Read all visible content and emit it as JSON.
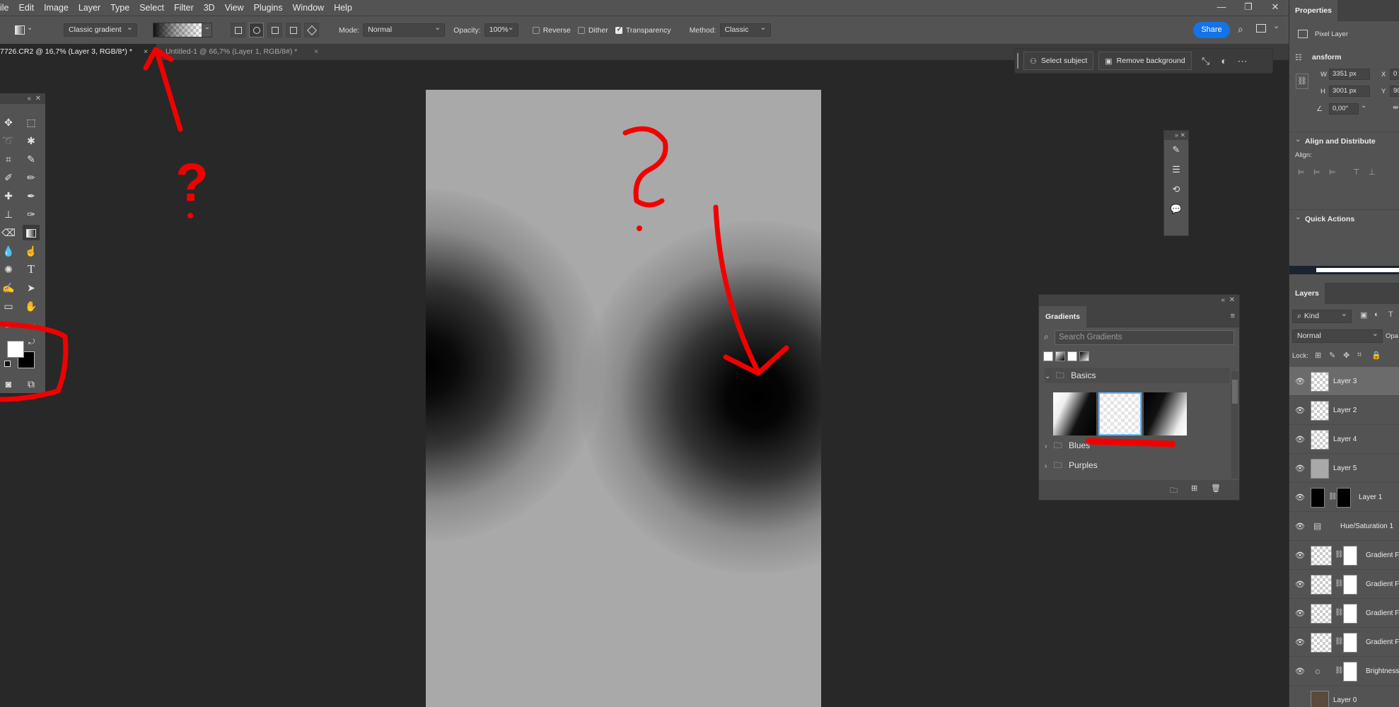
{
  "menu": [
    "ile",
    "Edit",
    "Image",
    "Layer",
    "Type",
    "Select",
    "Filter",
    "3D",
    "View",
    "Plugins",
    "Window",
    "Help"
  ],
  "window_controls": [
    "—",
    "❐",
    "✕"
  ],
  "options": {
    "gradient_type": "Classic gradient",
    "mode_label": "Mode:",
    "mode_value": "Normal",
    "opacity_label": "Opacity:",
    "opacity_value": "100%",
    "reverse": "Reverse",
    "dither": "Dither",
    "transparency": "Transparency",
    "transparency_checked": true,
    "method_label": "Method:",
    "method_value": "Classic",
    "share": "Share"
  },
  "tabs": [
    {
      "label": "7726.CR2 @ 16,7% (Layer 3, RGB/8*) *",
      "close": "×"
    },
    {
      "label": "Untitled-1 @ 66,7% (Layer 1, RGB/8#) *",
      "close": "×"
    }
  ],
  "context_bar": {
    "select_subject": "Select subject",
    "remove_background": "Remove background"
  },
  "gradients_panel": {
    "title": "Gradients",
    "search_placeholder": "Search Gradients",
    "folders": [
      "Basics",
      "Blues",
      "Purples"
    ]
  },
  "properties": {
    "title": "Properties",
    "kind": "Pixel Layer",
    "transform_label": "ansform",
    "w_label": "W",
    "w_value": "3351 px",
    "h_label": "H",
    "h_value": "3001 px",
    "x_label": "X",
    "x_value": "0 p",
    "y_label": "Y",
    "y_value": "90",
    "angle_value": "0,00°",
    "align_section": "Align and Distribute",
    "align_label": "Align:",
    "quick_actions": "Quick Actions"
  },
  "layers_panel": {
    "title": "Layers",
    "kind_filter": "Kind",
    "blend_mode": "Normal",
    "opacity_label": "Opa",
    "lock_label": "Lock:",
    "layers": [
      {
        "name": "Layer 3",
        "selected": true
      },
      {
        "name": "Layer 2"
      },
      {
        "name": "Layer 4"
      },
      {
        "name": "Layer 5"
      },
      {
        "name": "Layer 1"
      },
      {
        "name": "Hue/Saturation 1"
      },
      {
        "name": "Gradient F"
      },
      {
        "name": "Gradient F"
      },
      {
        "name": "Gradient F"
      },
      {
        "name": "Gradient F"
      },
      {
        "name": "Brightness"
      },
      {
        "name": "Layer 0"
      }
    ]
  },
  "annotations": [
    "?",
    "?"
  ],
  "colors": {
    "annotation_red": "#f20000",
    "accent_blue": "#1473e6",
    "panel_bg": "#535353",
    "workspace_bg": "#282828"
  }
}
